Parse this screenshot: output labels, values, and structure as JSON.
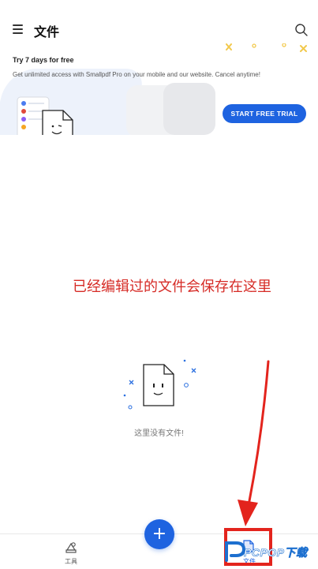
{
  "header": {
    "title": "文件"
  },
  "promo": {
    "title": "Try 7 days for free",
    "description": "Get unlimited access with Smallpdf Pro on your mobile and our website. Cancel anytime!",
    "cta_label": "START FREE TRIAL"
  },
  "annotation": {
    "text": "已经编辑过的文件会保存在这里"
  },
  "empty_state": {
    "text": "这里没有文件!"
  },
  "bottom_nav": {
    "items": [
      {
        "label": "工具",
        "icon": "tools-icon"
      },
      {
        "label": "文件",
        "icon": "file-icon"
      }
    ],
    "fab_symbol": "+"
  },
  "watermark": {
    "text": "PCPOP下载"
  },
  "colors": {
    "accent": "#1e63e0",
    "annotation": "#d62b26",
    "highlight_border": "#e3241d"
  }
}
